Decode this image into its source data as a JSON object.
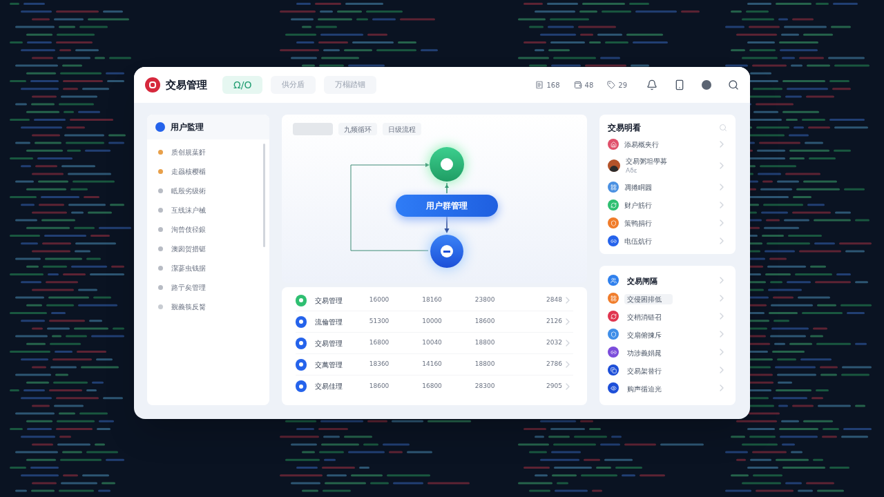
{
  "app": {
    "title": "交易管理"
  },
  "top_tabs": [
    {
      "label": "Ω/O",
      "selected": true
    },
    {
      "label": "供分盾",
      "selected": false
    },
    {
      "label": "万榻踏锢",
      "selected": false
    }
  ],
  "header_stats": [
    "168",
    "48",
    "29"
  ],
  "sidebar": {
    "title": "用户監理",
    "items": [
      {
        "label": "质创規葉姧",
        "color": "#e8a04a"
      },
      {
        "label": "走赑核樱楯",
        "color": "#e8a04a"
      },
      {
        "label": "眡殷劣级術",
        "color": "#b8bcc4"
      },
      {
        "label": "互线沫户械",
        "color": "#b8bcc4"
      },
      {
        "label": "洵曾伎径銀",
        "color": "#b8bcc4"
      },
      {
        "label": "澳囱贺措铤",
        "color": "#b8bcc4"
      },
      {
        "label": "潔蔘虫钱据",
        "color": "#b8bcc4"
      },
      {
        "label": "路亍矣管理",
        "color": "#b8bcc4"
      },
      {
        "label": "觐義筷反胬",
        "color": "#c8ccd2"
      }
    ]
  },
  "flow": {
    "tabs": [
      {
        "selected": true
      },
      {
        "label": "九频循环",
        "selected": false
      },
      {
        "label": "日级流程",
        "selected": false
      }
    ],
    "node_label": "用户群管理"
  },
  "table": {
    "rows": [
      {
        "name": "交易管理",
        "color": "#2fbf71",
        "values": [
          "16000",
          "18160",
          "23800",
          "2848"
        ]
      },
      {
        "name": "流倫管理",
        "color": "#2563eb",
        "values": [
          "51300",
          "10000",
          "18600",
          "2126"
        ]
      },
      {
        "name": "交易管理",
        "color": "#2563eb",
        "values": [
          "16800",
          "10040",
          "18800",
          "2032"
        ]
      },
      {
        "name": "交萬管理",
        "color": "#2563eb",
        "values": [
          "18360",
          "14160",
          "18800",
          "2786"
        ]
      },
      {
        "name": "交易佳理",
        "color": "#2563eb",
        "values": [
          "18600",
          "16800",
          "28300",
          "2905"
        ]
      }
    ]
  },
  "right_top": {
    "title": "交易明看",
    "items": [
      {
        "kind": "icon",
        "label": "添易概夹行",
        "color": "#e0506a"
      },
      {
        "kind": "avatar",
        "label": "交易粥坦學募",
        "sub": "Aδε"
      },
      {
        "kind": "icon",
        "label": "凋捲眮圓",
        "color": "#4a90e2"
      },
      {
        "kind": "icon",
        "label": "财户筋行",
        "color": "#2fbf71"
      },
      {
        "kind": "icon",
        "label": "策鸭捐行",
        "color": "#f07c2a"
      },
      {
        "kind": "icon",
        "label": "电伍炕行",
        "color": "#2563eb"
      }
    ]
  },
  "right_bottom": {
    "items": [
      {
        "kind": "header",
        "label": "交易闸隔",
        "color": "#2f80ed",
        "selected": false
      },
      {
        "label": "交侵困排低",
        "color": "#f07c2a",
        "selected": true
      },
      {
        "label": "交梢消链召",
        "color": "#e0354f",
        "selected": false
      },
      {
        "label": "交扇俯揀斥",
        "color": "#3f8ee8",
        "selected": false
      },
      {
        "label": "功涉義娟晁",
        "color": "#7c4ddb",
        "selected": false
      },
      {
        "label": "交易架替行",
        "color": "#1d4fd8",
        "selected": false
      },
      {
        "label": "购声循迫光",
        "color": "#1d4fd8",
        "selected": false
      }
    ]
  }
}
